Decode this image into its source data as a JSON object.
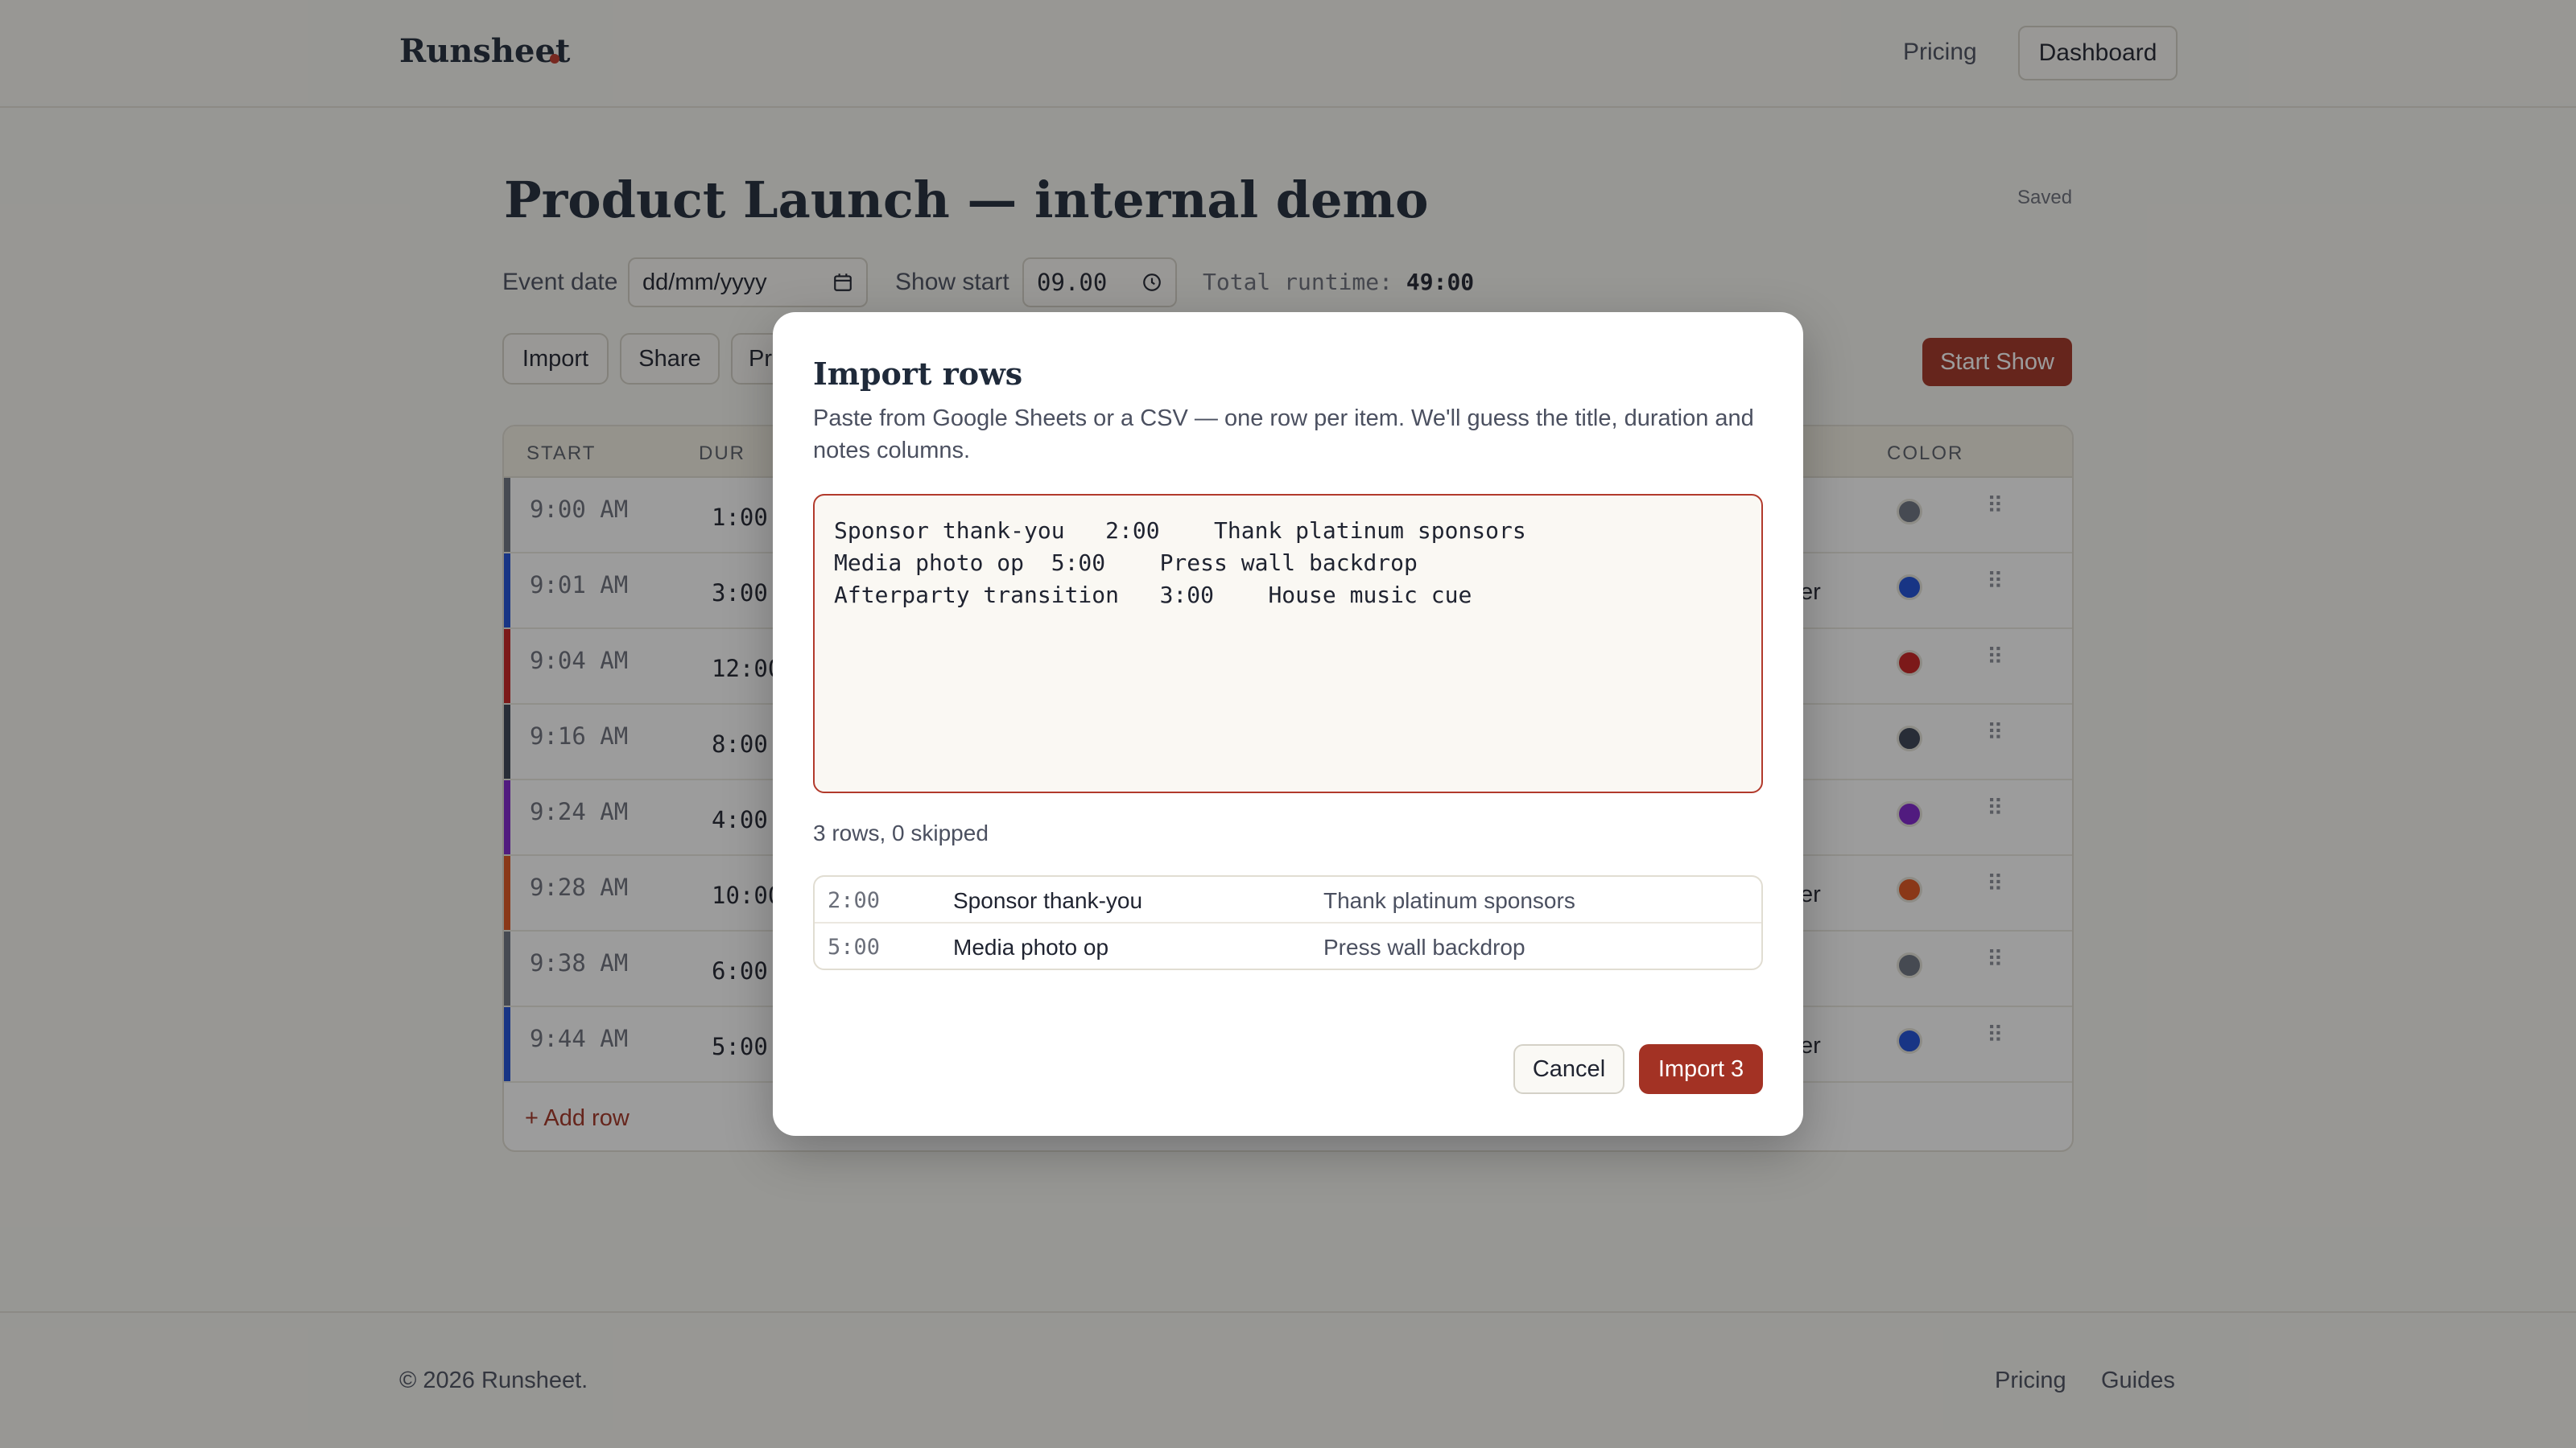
{
  "header": {
    "logo": "Runsheet",
    "nav_pricing": "Pricing",
    "nav_dashboard": "Dashboard"
  },
  "page": {
    "title": "Product Launch — internal demo",
    "saved_status": "Saved",
    "event_date_label": "Event date",
    "event_date_value": "dd/mm/yyyy",
    "show_start_label": "Show start",
    "show_start_value": "09.00",
    "total_runtime_label": "Total runtime:",
    "total_runtime_value": "49:00"
  },
  "toolbar": {
    "import_label": "Import",
    "share_label": "Share",
    "third_label": "Pr",
    "start_show_label": "Start Show"
  },
  "table": {
    "headers": {
      "start": "START",
      "dur": "DUR",
      "color": "COLOR"
    },
    "rows": [
      {
        "start": "9:00 AM",
        "dur": "1:00",
        "right": "",
        "color": "#6b7280"
      },
      {
        "start": "9:01 AM",
        "dur": "3:00",
        "right": "er",
        "color": "#1d4ed8"
      },
      {
        "start": "9:04 AM",
        "dur": "12:00",
        "right": "",
        "color": "#c81e1e"
      },
      {
        "start": "9:16 AM",
        "dur": "8:00",
        "right": "",
        "color": "#374151"
      },
      {
        "start": "9:24 AM",
        "dur": "4:00",
        "right": "",
        "color": "#7e22ce"
      },
      {
        "start": "9:28 AM",
        "dur": "10:00",
        "right": "er",
        "color": "#e0541c"
      },
      {
        "start": "9:38 AM",
        "dur": "6:00",
        "right": "",
        "color": "#6b7280"
      },
      {
        "start": "9:44 AM",
        "dur": "5:00",
        "right": "er",
        "color": "#1d4ed8"
      }
    ],
    "add_row_label": "+ Add row"
  },
  "modal": {
    "title": "Import rows",
    "subtitle": "Paste from Google Sheets or a CSV — one row per item. We'll guess the title, duration and notes columns.",
    "textarea_value": "Sponsor thank-you   2:00    Thank platinum sponsors\nMedia photo op  5:00    Press wall backdrop\nAfterparty transition   3:00    House music cue",
    "count_text": "3 rows, 0 skipped",
    "preview": [
      {
        "dur": "2:00",
        "title": "Sponsor thank-you",
        "notes": "Thank platinum sponsors"
      },
      {
        "dur": "5:00",
        "title": "Media photo op",
        "notes": "Press wall backdrop"
      },
      {
        "dur": "3:00",
        "title": "Afterparty transition",
        "notes": "House music cue"
      }
    ],
    "cancel_label": "Cancel",
    "import_label": "Import 3"
  },
  "footer": {
    "copyright": "© 2026 Runsheet.",
    "link_pricing": "Pricing",
    "link_guides": "Guides"
  },
  "icons": {
    "calendar": "calendar-icon",
    "clock": "clock-icon",
    "grip": "drag-handle-icon"
  },
  "colors": {
    "accent": "#a33224",
    "background": "#f7f6f1"
  }
}
